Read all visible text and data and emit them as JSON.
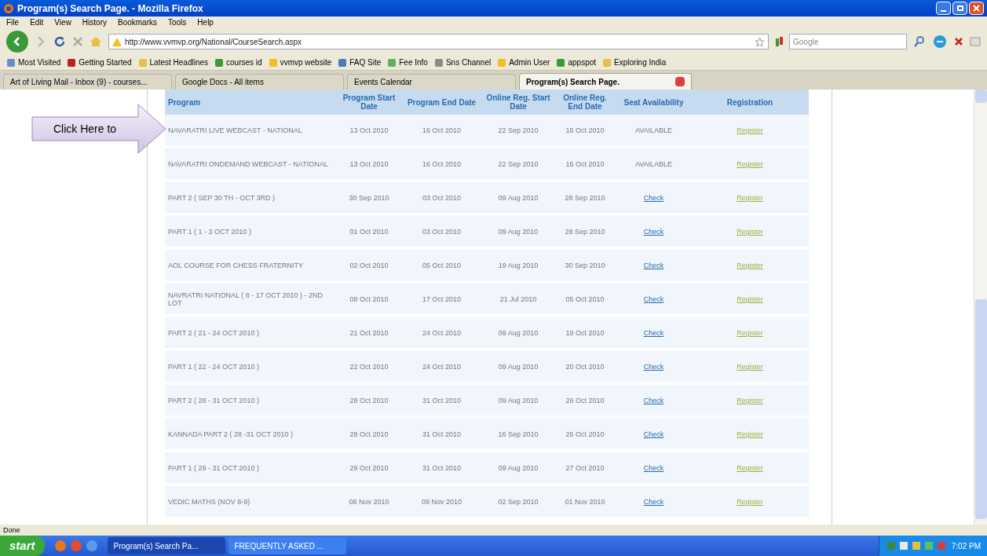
{
  "window": {
    "title": "Program(s) Search Page. - Mozilla Firefox"
  },
  "menu": [
    "File",
    "Edit",
    "View",
    "History",
    "Bookmarks",
    "Tools",
    "Help"
  ],
  "address": {
    "value": "http://www.vvmvp.org/National/CourseSearch.aspx"
  },
  "search": {
    "placeholder": "Google"
  },
  "bookmarks": [
    "Most Visited",
    "Getting Started",
    "Latest Headlines",
    "courses id",
    "vvmvp website",
    "FAQ Site",
    "Fee Info",
    "Sns Channel",
    "Admin User",
    "appspot",
    "Exploring India"
  ],
  "tabs": [
    {
      "label": "Art of Living Mail - Inbox (9) - courses...",
      "selected": false
    },
    {
      "label": "Google Docs - All items",
      "selected": false
    },
    {
      "label": "Events Calendar",
      "selected": false
    },
    {
      "label": "Program(s) Search Page.",
      "selected": true
    }
  ],
  "callout": {
    "text": "Click Here to"
  },
  "table": {
    "columns": [
      "Program",
      "Program Start Date",
      "Program End Date",
      "Online Reg. Start Date",
      "Online Reg. End Date",
      "Seat Availability",
      "Registration"
    ],
    "rows": [
      {
        "program": "NAVARATRI LIVE WEBCAST - NATIONAL",
        "start": "13 Oct 2010",
        "end": "16 Oct 2010",
        "reg_start": "22 Sep 2010",
        "reg_end": "16 Oct 2010",
        "seat": {
          "kind": "text",
          "text": "AVAILABLE"
        },
        "registration": "Register"
      },
      {
        "program": "NAVARATRI ONDEMAND WEBCAST - NATIONAL",
        "start": "13 Oct 2010",
        "end": "16 Oct 2010",
        "reg_start": "22 Sep 2010",
        "reg_end": "16 Oct 2010",
        "seat": {
          "kind": "text",
          "text": "AVAILABLE"
        },
        "registration": "Register"
      },
      {
        "program": "PART 2 ( SEP 30 TH - OCT 3RD )",
        "start": "30 Sep 2010",
        "end": "03 Oct 2010",
        "reg_start": "09 Aug 2010",
        "reg_end": "28 Sep 2010",
        "seat": {
          "kind": "link",
          "text": "Check"
        },
        "registration": "Register"
      },
      {
        "program": "PART 1 ( 1 - 3 OCT 2010 )",
        "start": "01 Oct 2010",
        "end": "03 Oct 2010",
        "reg_start": "09 Aug 2010",
        "reg_end": "28 Sep 2010",
        "seat": {
          "kind": "link",
          "text": "Check"
        },
        "registration": "Register"
      },
      {
        "program": "AOL COURSE FOR CHESS FRATERNITY",
        "start": "02 Oct 2010",
        "end": "05 Oct 2010",
        "reg_start": "19 Aug 2010",
        "reg_end": "30 Sep 2010",
        "seat": {
          "kind": "link",
          "text": "Check"
        },
        "registration": "Register"
      },
      {
        "program": "NAVRATRI NATIONAL ( 8 - 17 OCT 2010 ) - 2ND LOT",
        "start": "08 Oct 2010",
        "end": "17 Oct 2010",
        "reg_start": "21 Jul 2010",
        "reg_end": "05 Oct 2010",
        "seat": {
          "kind": "link",
          "text": "Check"
        },
        "registration": "Register"
      },
      {
        "program": "PART 2 ( 21 - 24 OCT 2010 )",
        "start": "21 Oct 2010",
        "end": "24 Oct 2010",
        "reg_start": "09 Aug 2010",
        "reg_end": "19 Oct 2010",
        "seat": {
          "kind": "link",
          "text": "Check"
        },
        "registration": "Register"
      },
      {
        "program": "PART 1 ( 22 - 24 OCT 2010 )",
        "start": "22 Oct 2010",
        "end": "24 Oct 2010",
        "reg_start": "09 Aug 2010",
        "reg_end": "20 Oct 2010",
        "seat": {
          "kind": "link",
          "text": "Check"
        },
        "registration": "Register"
      },
      {
        "program": "PART 2 ( 28 - 31 OCT 2010 )",
        "start": "28 Oct 2010",
        "end": "31 Oct 2010",
        "reg_start": "09 Aug 2010",
        "reg_end": "26 Oct 2010",
        "seat": {
          "kind": "link",
          "text": "Check"
        },
        "registration": "Register"
      },
      {
        "program": "KANNADA PART 2 ( 28 -31 OCT 2010 )",
        "start": "28 Oct 2010",
        "end": "31 Oct 2010",
        "reg_start": "16 Sep 2010",
        "reg_end": "26 Oct 2010",
        "seat": {
          "kind": "link",
          "text": "Check"
        },
        "registration": "Register"
      },
      {
        "program": "PART 1 ( 29 - 31 OCT 2010 )",
        "start": "29 Oct 2010",
        "end": "31 Oct 2010",
        "reg_start": "09 Aug 2010",
        "reg_end": "27 Oct 2010",
        "seat": {
          "kind": "link",
          "text": "Check"
        },
        "registration": "Register"
      },
      {
        "program": "VEDIC MATHS (NOV 8-9)",
        "start": "08 Nov 2010",
        "end": "09 Nov 2010",
        "reg_start": "02 Sep 2010",
        "reg_end": "01 Nov 2010",
        "seat": {
          "kind": "link",
          "text": "Check"
        },
        "registration": "Register"
      }
    ]
  },
  "status_bar": {
    "text": "Done"
  },
  "taskbar": {
    "start": "start",
    "tasks": [
      {
        "label": "Program(s) Search Pa...",
        "selected": true
      },
      {
        "label": "FREQUENTLY ASKED ...",
        "selected": false
      }
    ],
    "clock": "7:02 PM"
  }
}
